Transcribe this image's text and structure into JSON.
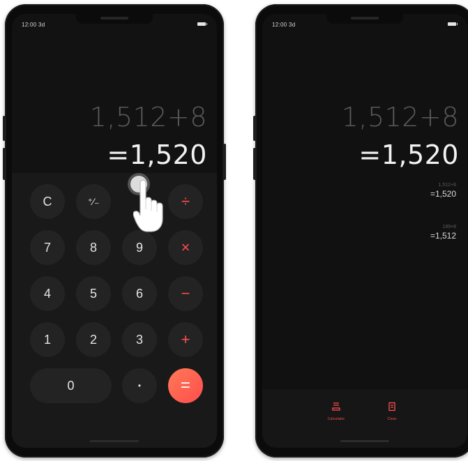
{
  "status_bar": {
    "time": "12:00 3d"
  },
  "left_screen": {
    "expression": "1,512+8",
    "result": "=1,520",
    "keypad": {
      "clear": "C",
      "sign": "⁺⁄₋",
      "divide": "÷",
      "seven": "7",
      "eight": "8",
      "nine": "9",
      "multiply": "×",
      "four": "4",
      "five": "5",
      "six": "6",
      "minus": "−",
      "one": "1",
      "two": "2",
      "three": "3",
      "plus": "+",
      "zero": "0",
      "dot": "•",
      "equals": "="
    }
  },
  "right_screen": {
    "expression": "1,512+8",
    "result": "=1,520",
    "history": [
      {
        "expression": "1,512+8",
        "result": "=1,520"
      },
      {
        "expression": "189×8",
        "result": "=1,512"
      }
    ],
    "toolbar": {
      "calculator_label": "Calculator",
      "clear_label": "Clear"
    }
  },
  "colors": {
    "accent": "#ff4f4f",
    "equals_gradient_start": "#ff7a56",
    "equals_gradient_end": "#ff4d4d",
    "screen_background": "#111111",
    "key_background": "#232323"
  },
  "icons": [
    "hand-pointer-icon",
    "battery-icon",
    "calculator-icon",
    "clear-history-icon"
  ]
}
